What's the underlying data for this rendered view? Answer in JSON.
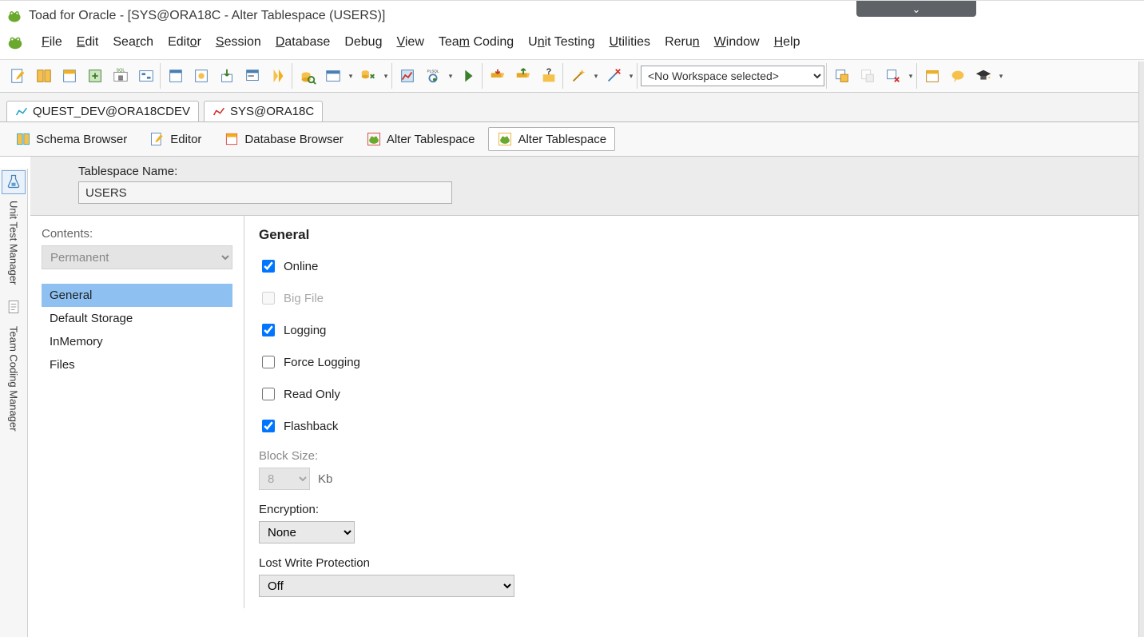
{
  "window": {
    "title": "Toad for Oracle - [SYS@ORA18C - Alter Tablespace (USERS)]"
  },
  "top_pill": {
    "icon": "chevron-down"
  },
  "menu": {
    "items": [
      "File",
      "Edit",
      "Search",
      "Editor",
      "Session",
      "Database",
      "Debug",
      "View",
      "Team Coding",
      "Unit Testing",
      "Utilities",
      "Rerun",
      "Window",
      "Help"
    ]
  },
  "toolbar": {
    "workspace_placeholder": "<No Workspace selected>"
  },
  "connection_tabs": [
    {
      "label": "QUEST_DEV@ORA18CDEV",
      "active": false,
      "accent": "#2aa3c9"
    },
    {
      "label": "SYS@ORA18C",
      "active": true,
      "accent": "#d2322d"
    }
  ],
  "sub_tabs": [
    {
      "label": "Schema Browser",
      "icon": "schema-browser-icon",
      "active": false
    },
    {
      "label": "Editor",
      "icon": "editor-icon",
      "active": false
    },
    {
      "label": "Database Browser",
      "icon": "db-browser-icon",
      "active": false
    },
    {
      "label": "Alter Tablespace",
      "icon": "alter-tablespace-icon",
      "active": false
    },
    {
      "label": "Alter Tablespace",
      "icon": "alter-tablespace-icon",
      "active": true
    }
  ],
  "side_panels": [
    {
      "label": "Unit Test Manager",
      "icon": "flask-icon",
      "active": true
    },
    {
      "label": "Team Coding Manager",
      "icon": "doc-icon",
      "active": false
    }
  ],
  "header": {
    "name_label": "Tablespace Name:",
    "name_value": "USERS"
  },
  "left": {
    "contents_label": "Contents:",
    "contents_value": "Permanent",
    "sections": [
      "General",
      "Default Storage",
      "InMemory",
      "Files"
    ],
    "selected": "General"
  },
  "general": {
    "title": "General",
    "online": {
      "label": "Online",
      "checked": true
    },
    "bigfile": {
      "label": "Big File",
      "checked": false,
      "disabled": true
    },
    "logging": {
      "label": "Logging",
      "checked": true
    },
    "force_logging": {
      "label": "Force Logging",
      "checked": false
    },
    "read_only": {
      "label": "Read Only",
      "checked": false
    },
    "flashback": {
      "label": "Flashback",
      "checked": true
    },
    "block_size": {
      "label": "Block Size:",
      "value": "8",
      "unit": "Kb",
      "disabled": true
    },
    "encryption": {
      "label": "Encryption:",
      "value": "None"
    },
    "lost_write": {
      "label": "Lost Write Protection",
      "value": "Off"
    }
  }
}
